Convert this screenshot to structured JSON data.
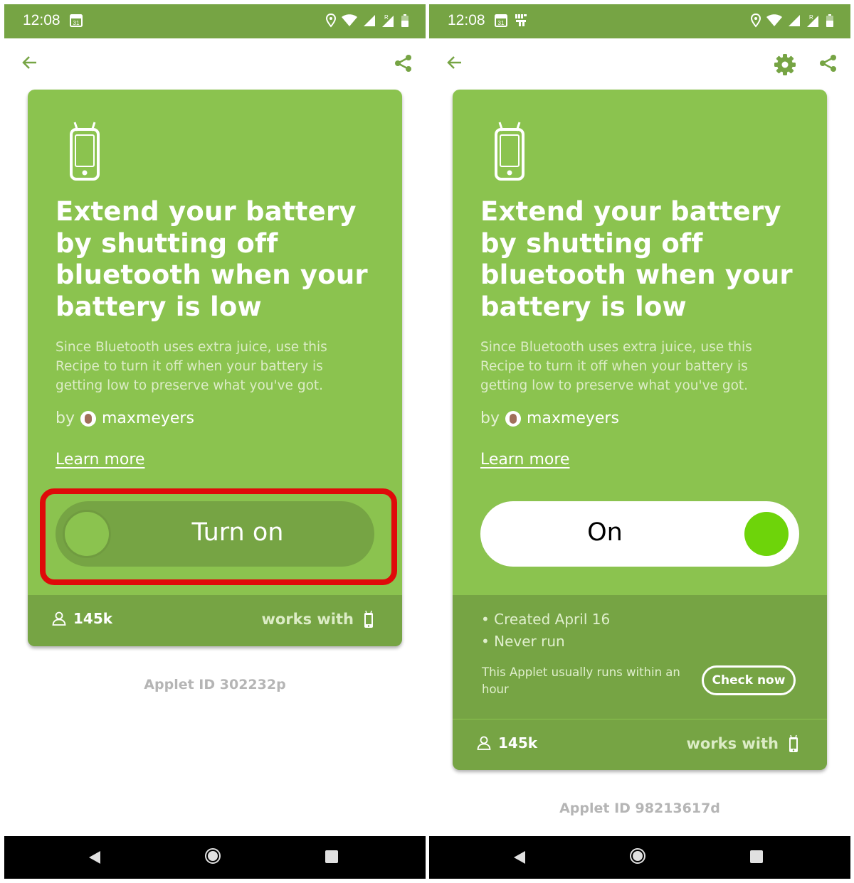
{
  "screens": [
    {
      "id": "left",
      "status_time": "12:08",
      "calendar_day": "31",
      "applet": {
        "title": "Extend your battery by shutting off bluetooth when your battery is low",
        "description": "Since Bluetooth uses extra juice, use this Recipe to turn it off when your battery is getting low to preserve what you've got.",
        "by_label": "by",
        "author": "maxmeyers",
        "learn_more": "Learn more",
        "toggle_label": "Turn on",
        "toggle_on": false,
        "users_count": "145k",
        "works_with": "works with"
      },
      "applet_id": "Applet ID 302232p"
    },
    {
      "id": "right",
      "status_time": "12:08",
      "calendar_day": "31",
      "applet": {
        "title": "Extend your battery by shutting off bluetooth when your battery is low",
        "description": "Since Bluetooth uses extra juice, use this Recipe to turn it off when your battery is getting low to preserve what you've got.",
        "by_label": "by",
        "author": "maxmeyers",
        "learn_more": "Learn more",
        "toggle_label": "On",
        "toggle_on": true,
        "details": [
          "• Created April 16",
          "• Never run"
        ],
        "run_note": "This Applet usually runs within an hour",
        "check_now": "Check now",
        "users_count": "145k",
        "works_with": "works with"
      },
      "applet_id": "Applet ID 98213617d"
    }
  ],
  "icons": {
    "back": "arrow-left-icon",
    "share": "share-icon",
    "settings": "gear-icon",
    "device": "android-phone-icon",
    "user": "user-icon"
  },
  "colors": {
    "card": "#8bc34f",
    "band": "#76a444",
    "status_bar": "#76a444",
    "toggle_knob_on": "#6ed40a",
    "highlight": "#df0a0a"
  }
}
